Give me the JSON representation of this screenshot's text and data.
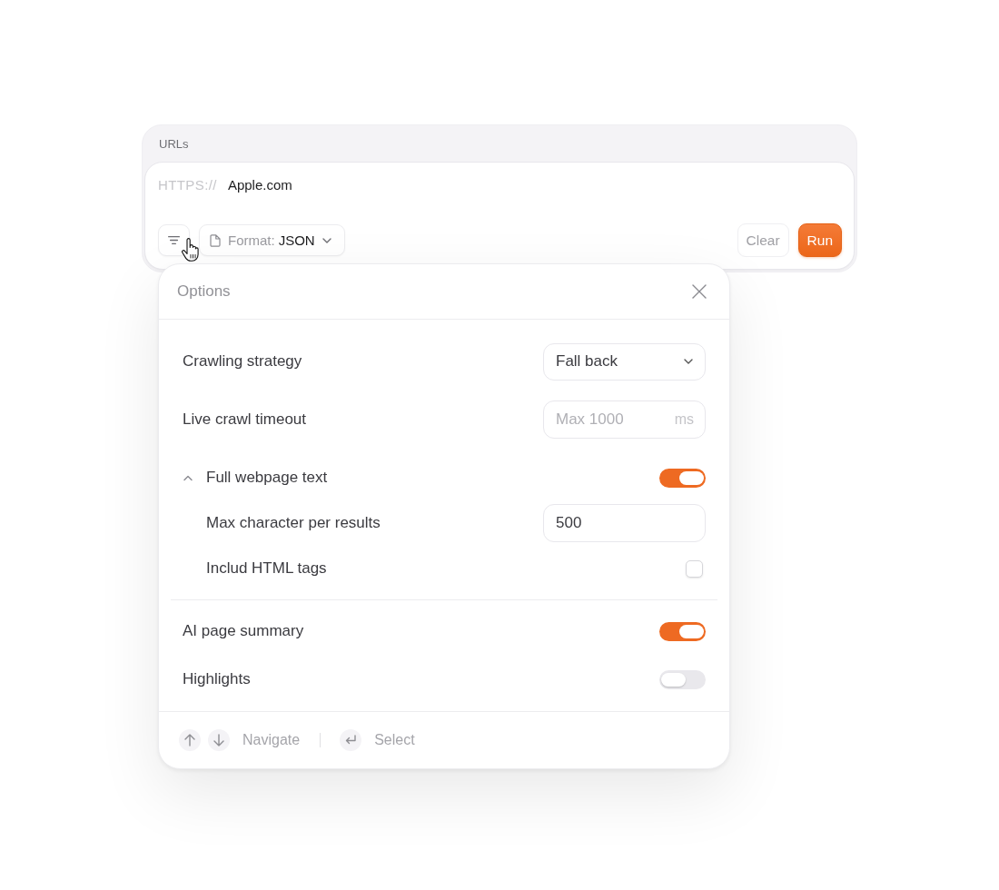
{
  "urls_card": {
    "label": "URLs",
    "prefix": "HTTPS://",
    "value": "Apple.com",
    "format": {
      "label": "Format:",
      "value": "JSON"
    },
    "buttons": [
      {
        "label": "Clear",
        "kind": "secondary"
      },
      {
        "label": "Run",
        "kind": "primary"
      }
    ]
  },
  "options_panel": {
    "title": "Options",
    "sections": [
      {
        "rows": [
          {
            "kind": "select",
            "label": "Crawling strategy",
            "value": "Fall back"
          },
          {
            "kind": "input",
            "label": "Live crawl timeout",
            "placeholder": "Max 1000",
            "suffix": "ms"
          },
          {
            "kind": "toggle",
            "label": "Full webpage text",
            "on": true,
            "expanded": true,
            "children": [
              {
                "kind": "input",
                "label": "Max character per results",
                "value": "500"
              },
              {
                "kind": "checkbox",
                "label": "Includ HTML tags",
                "checked": false
              }
            ]
          }
        ]
      },
      {
        "rows": [
          {
            "kind": "toggle",
            "label": "AI page summary",
            "on": true
          },
          {
            "kind": "toggle",
            "label": "Highlights",
            "on": false
          }
        ]
      }
    ],
    "footer": [
      {
        "kind": "arrows",
        "label": "Navigate"
      },
      {
        "kind": "enter",
        "label": "Select"
      }
    ]
  }
}
